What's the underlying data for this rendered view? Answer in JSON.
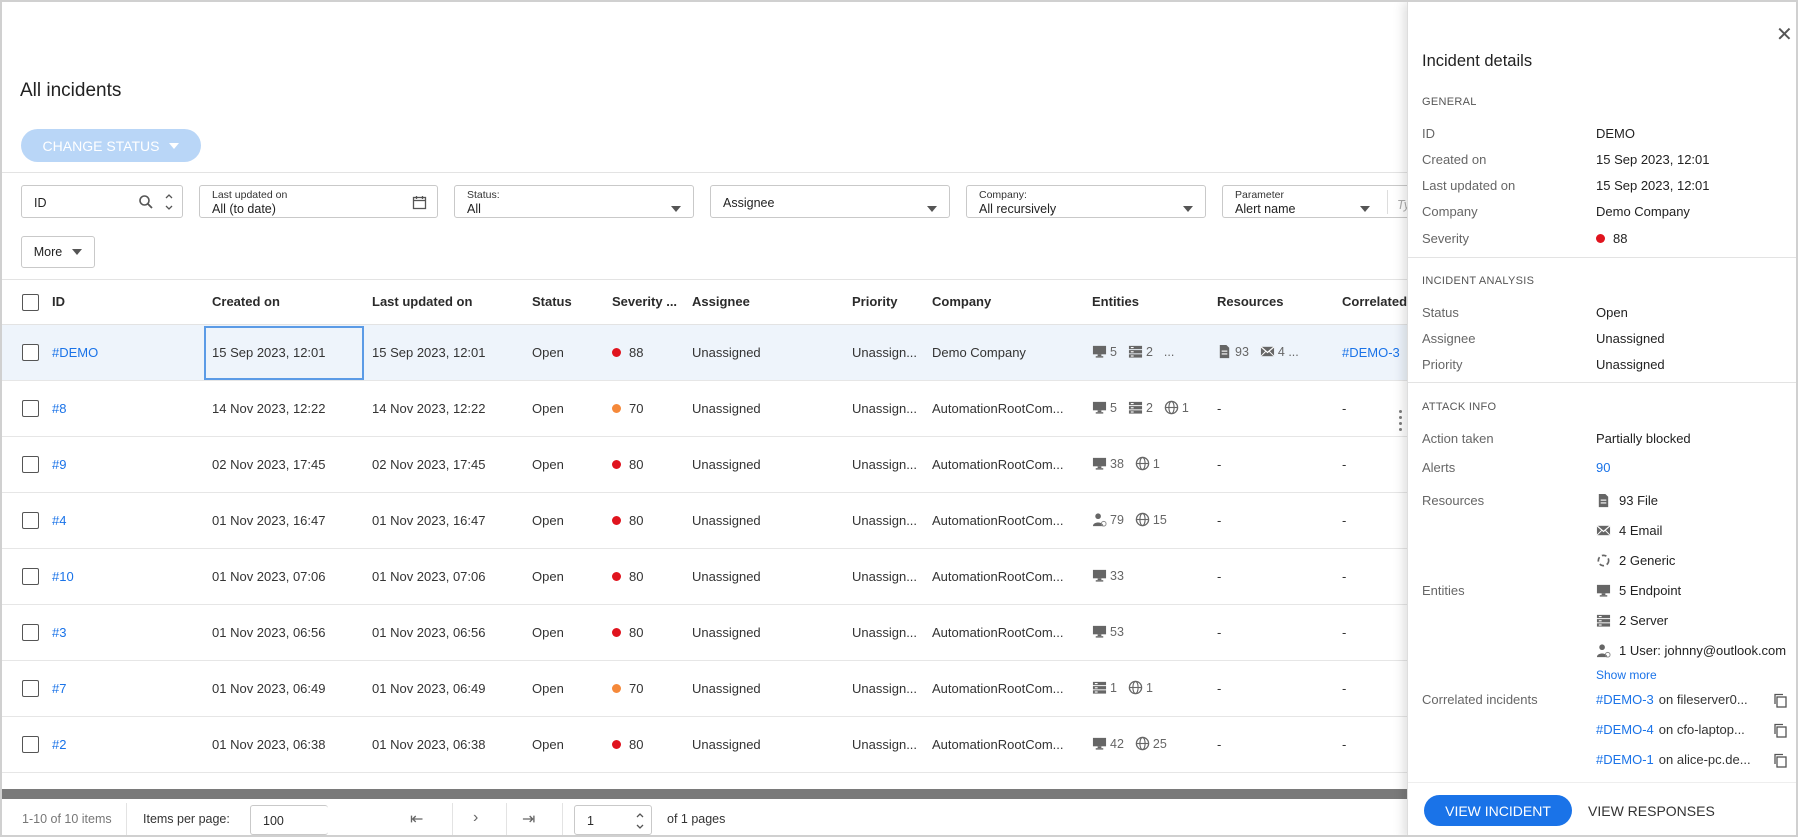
{
  "page": {
    "title": "All incidents",
    "change_status": "CHANGE STATUS"
  },
  "filters": {
    "id": {
      "value": "ID"
    },
    "last_updated": {
      "label": "Last updated on",
      "value": "All (to date)"
    },
    "status": {
      "label": "Status:",
      "value": "All"
    },
    "assignee": {
      "value": "Assignee"
    },
    "company": {
      "label": "Company:",
      "value": "All recursively"
    },
    "parameter": {
      "label": "Parameter",
      "value": "Alert name",
      "placeholder": "Ty"
    },
    "more": "More"
  },
  "table": {
    "headers": [
      "ID",
      "Created on",
      "Last updated on",
      "Status",
      "Severity ...",
      "Assignee",
      "Priority",
      "Company",
      "Entities",
      "Resources",
      "Correlated"
    ],
    "rows": [
      {
        "id": "#DEMO",
        "created": "15 Sep 2023, 12:01",
        "updated": "15 Sep 2023, 12:01",
        "status": "Open",
        "severity": "88",
        "sev_color": "#e0141e",
        "assignee": "Unassigned",
        "priority": "Unassign...",
        "company": "Demo Company",
        "entities": [
          {
            "icon": "monitor-icon",
            "count": "5"
          },
          {
            "icon": "server-icon",
            "count": "2"
          },
          {
            "icon": "more",
            "count": "..."
          }
        ],
        "resources": [
          {
            "icon": "file-icon",
            "count": "93"
          },
          {
            "icon": "email-icon",
            "count": "4 ..."
          }
        ],
        "correlated": "#DEMO-3"
      },
      {
        "id": "#8",
        "created": "14 Nov 2023, 12:22",
        "updated": "14 Nov 2023, 12:22",
        "status": "Open",
        "severity": "70",
        "sev_color": "#f5893a",
        "assignee": "Unassigned",
        "priority": "Unassign...",
        "company": "AutomationRootCom...",
        "entities": [
          {
            "icon": "monitor-icon",
            "count": "5"
          },
          {
            "icon": "server-icon",
            "count": "2"
          },
          {
            "icon": "globe-icon",
            "count": "1"
          }
        ],
        "resources_text": "-",
        "correlated": "-"
      },
      {
        "id": "#9",
        "created": "02 Nov 2023, 17:45",
        "updated": "02 Nov 2023, 17:45",
        "status": "Open",
        "severity": "80",
        "sev_color": "#e0141e",
        "assignee": "Unassigned",
        "priority": "Unassign...",
        "company": "AutomationRootCom...",
        "entities": [
          {
            "icon": "monitor-icon",
            "count": "38"
          },
          {
            "icon": "globe-icon",
            "count": "1"
          }
        ],
        "resources_text": "-",
        "correlated": "-"
      },
      {
        "id": "#4",
        "created": "01 Nov 2023, 16:47",
        "updated": "01 Nov 2023, 16:47",
        "status": "Open",
        "severity": "80",
        "sev_color": "#e0141e",
        "assignee": "Unassigned",
        "priority": "Unassign...",
        "company": "AutomationRootCom...",
        "entities": [
          {
            "icon": "user-icon",
            "count": "79"
          },
          {
            "icon": "globe-icon",
            "count": "15"
          }
        ],
        "resources_text": "-",
        "correlated": "-"
      },
      {
        "id": "#10",
        "created": "01 Nov 2023, 07:06",
        "updated": "01 Nov 2023, 07:06",
        "status": "Open",
        "severity": "80",
        "sev_color": "#e0141e",
        "assignee": "Unassigned",
        "priority": "Unassign...",
        "company": "AutomationRootCom...",
        "entities": [
          {
            "icon": "monitor-icon",
            "count": "33"
          }
        ],
        "resources_text": "-",
        "correlated": "-"
      },
      {
        "id": "#3",
        "created": "01 Nov 2023, 06:56",
        "updated": "01 Nov 2023, 06:56",
        "status": "Open",
        "severity": "80",
        "sev_color": "#e0141e",
        "assignee": "Unassigned",
        "priority": "Unassign...",
        "company": "AutomationRootCom...",
        "entities": [
          {
            "icon": "monitor-icon",
            "count": "53"
          }
        ],
        "resources_text": "-",
        "correlated": "-"
      },
      {
        "id": "#7",
        "created": "01 Nov 2023, 06:49",
        "updated": "01 Nov 2023, 06:49",
        "status": "Open",
        "severity": "70",
        "sev_color": "#f5893a",
        "assignee": "Unassigned",
        "priority": "Unassign...",
        "company": "AutomationRootCom...",
        "entities": [
          {
            "icon": "server-icon",
            "count": "1"
          },
          {
            "icon": "globe-icon",
            "count": "1"
          }
        ],
        "resources_text": "-",
        "correlated": "-"
      },
      {
        "id": "#2",
        "created": "01 Nov 2023, 06:38",
        "updated": "01 Nov 2023, 06:38",
        "status": "Open",
        "severity": "80",
        "sev_color": "#e0141e",
        "assignee": "Unassigned",
        "priority": "Unassign...",
        "company": "AutomationRootCom...",
        "entities": [
          {
            "icon": "monitor-icon",
            "count": "42"
          },
          {
            "icon": "globe-icon",
            "count": "25"
          }
        ],
        "resources_text": "-",
        "correlated": "-"
      }
    ]
  },
  "footer": {
    "range": "1-10 of 10 items",
    "per_page_label": "Items per page:",
    "per_page": "100",
    "page": "1",
    "of_pages": "of 1 pages"
  },
  "panel": {
    "title": "Incident details",
    "general": {
      "section": "GENERAL",
      "rows": [
        {
          "k": "ID",
          "v": "DEMO"
        },
        {
          "k": "Created on",
          "v": "15 Sep 2023, 12:01"
        },
        {
          "k": "Last updated on",
          "v": "15 Sep 2023, 12:01"
        },
        {
          "k": "Company",
          "v": "Demo Company"
        }
      ],
      "severity_label": "Severity",
      "severity": "88",
      "severity_color": "#e0141e"
    },
    "analysis": {
      "section": "INCIDENT ANALYSIS",
      "rows": [
        {
          "k": "Status",
          "v": "Open"
        },
        {
          "k": "Assignee",
          "v": "Unassigned"
        },
        {
          "k": "Priority",
          "v": "Unassigned"
        }
      ]
    },
    "attack": {
      "section": "ATTACK INFO",
      "action_label": "Action taken",
      "action": "Partially blocked",
      "alerts_label": "Alerts",
      "alerts": "90",
      "resources_label": "Resources",
      "resources": [
        {
          "icon": "file-icon",
          "text": "93 File"
        },
        {
          "icon": "email-icon",
          "text": "4 Email"
        },
        {
          "icon": "generic-icon",
          "text": "2 Generic"
        }
      ],
      "entities_label": "Entities",
      "entities": [
        {
          "icon": "monitor-icon",
          "text": "5 Endpoint"
        },
        {
          "icon": "server-icon",
          "text": "2 Server"
        },
        {
          "icon": "user-icon",
          "text": "1 User: johnny@outlook.com"
        }
      ],
      "show_more": "Show more",
      "correlated_label": "Correlated incidents",
      "correlated": [
        {
          "id": "#DEMO-3",
          "text": "on fileserver0..."
        },
        {
          "id": "#DEMO-4",
          "text": "on cfo-laptop..."
        },
        {
          "id": "#DEMO-1",
          "text": "on alice-pc.de..."
        }
      ]
    },
    "view_incident": "VIEW INCIDENT",
    "view_responses": "VIEW RESPONSES"
  }
}
